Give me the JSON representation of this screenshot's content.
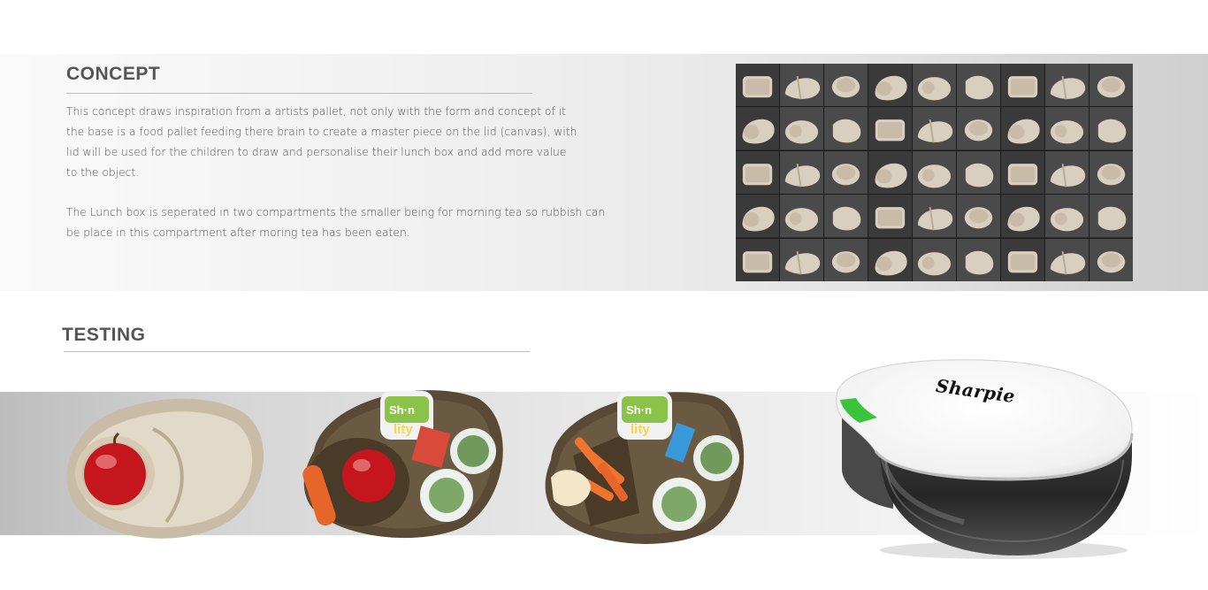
{
  "concept": {
    "title": "CONCEPT",
    "paragraph1": [
      "This concept draws inspiration from a artists pallet, not only with the form and concept of it",
      "the base is a food pallet feeding there brain to create a master piece on the lid (canvas), with",
      "lid will be used for the children to draw and personalise their lunch box and add more value",
      "to the object."
    ],
    "paragraph2": [
      "The Lunch box is seperated in two compartments the smaller being for morning tea so rubbish can",
      "be place in this compartment after moring tea has been eaten."
    ]
  },
  "testing": {
    "title": "TESTING"
  },
  "product": {
    "lid_logo": "Sharpie"
  },
  "colors": {
    "heading": "#555555",
    "body_text": "#555555",
    "cardboard": "#d9cfbf",
    "accent_green": "#3bc43b"
  }
}
